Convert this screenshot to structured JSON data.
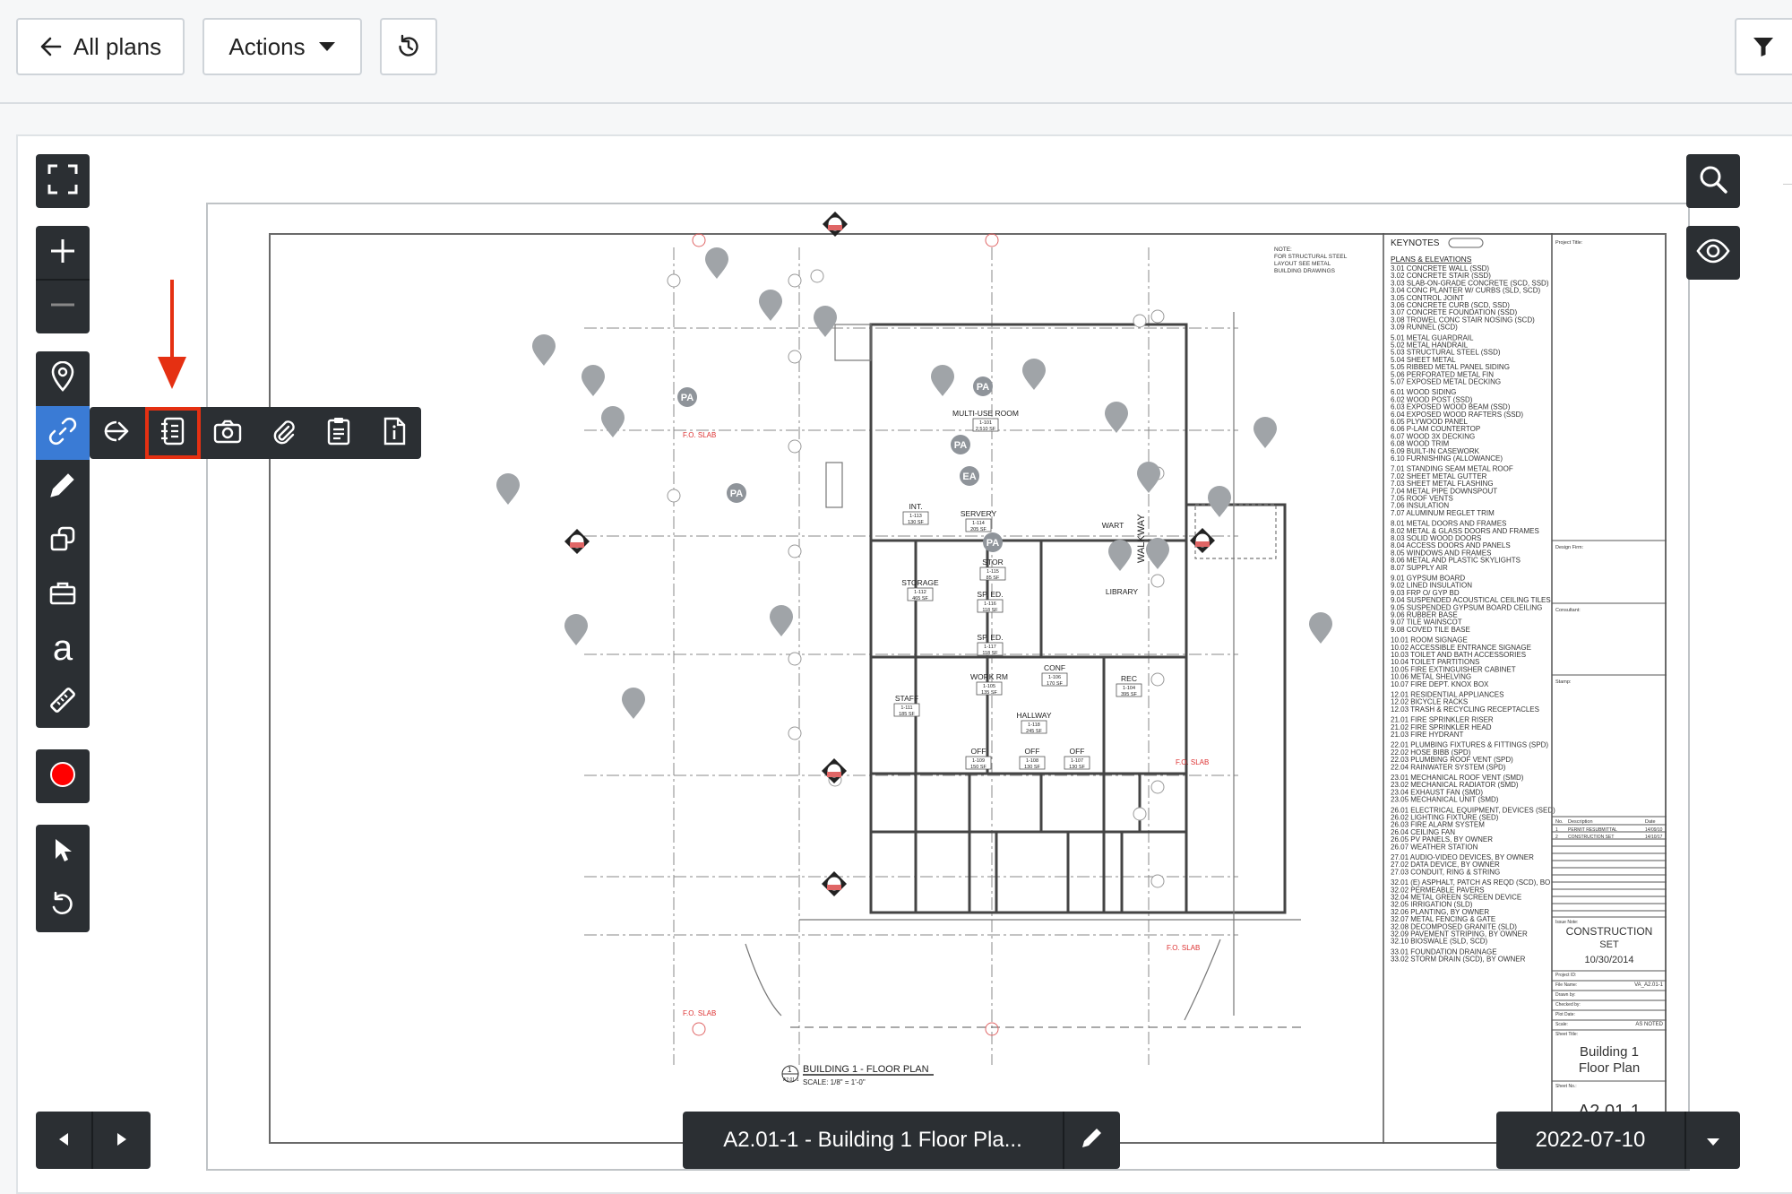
{
  "toolbar": {
    "all_plans_label": "All plans",
    "actions_label": "Actions"
  },
  "plan": {
    "keynotes_title": "KEYNOTES",
    "keynotes_section": "PLANS & ELEVATIONS",
    "keynotes": [
      "3.01  CONCRETE WALL (SSD)",
      "3.02  CONCRETE STAIR (SSD)",
      "3.03  SLAB-ON-GRADE CONCRETE (SCD, SSD)",
      "3.04  CONC PLANTER W/ CURBS (SLD, SCD)",
      "3.05  CONTROL JOINT",
      "3.06  CONCRETE CURB (SCD, SSD)",
      "3.07  CONCRETE FOUNDATION (SSD)",
      "3.08  TROWEL CONC STAIR NOSING (SCD)",
      "3.09  RUNNEL (SCD)",
      "",
      "5.01  METAL GUARDRAIL",
      "5.02  METAL HANDRAIL",
      "5.03  STRUCTURAL STEEL (SSD)",
      "5.04  SHEET METAL",
      "5.05  RIBBED METAL PANEL SIDING",
      "5.06  PERFORATED METAL FIN",
      "5.07  EXPOSED METAL DECKING",
      "",
      "6.01  WOOD SIDING",
      "6.02  WOOD POST (SSD)",
      "6.03  EXPOSED WOOD BEAM (SSD)",
      "6.04  EXPOSED WOOD RAFTERS (SSD)",
      "6.05  PLYWOOD PANEL",
      "6.06  P-LAM COUNTERTOP",
      "6.07  WOOD 3X DECKING",
      "6.08  WOOD TRIM",
      "6.09  BUILT-IN CASEWORK",
      "6.10  FURNISHING (ALLOWANCE)",
      "",
      "7.01  STANDING SEAM METAL ROOF",
      "7.02  SHEET METAL GUTTER",
      "7.03  SHEET METAL FLASHING",
      "7.04  METAL PIPE DOWNSPOUT",
      "7.05  ROOF VENTS",
      "7.06  INSULATION",
      "7.07  ALUMINUM REGLET TRIM",
      "",
      "8.01  METAL DOORS AND FRAMES",
      "8.02  METAL & GLASS DOORS AND FRAMES",
      "8.03  SOLID WOOD DOORS",
      "8.04  ACCESS DOORS AND PANELS",
      "8.05  WINDOWS AND FRAMES",
      "8.06  METAL AND PLASTIC SKYLIGHTS",
      "8.07  SUPPLY AIR",
      "",
      "9.01  GYPSUM BOARD",
      "9.02  LINED INSULATION",
      "9.03  FRP O/ GYP BD",
      "9.04  SUSPENDED ACOUSTICAL CEILING TILES",
      "9.05  SUSPENDED GYPSUM BOARD CEILING",
      "9.06  RUBBER BASE",
      "9.07  TILE WAINSCOT",
      "9.08  COVED TILE BASE",
      "",
      "10.01 ROOM SIGNAGE",
      "10.02 ACCESSIBLE ENTRANCE SIGNAGE",
      "10.03 TOILET AND BATH ACCESSORIES",
      "10.04 TOILET PARTITIONS",
      "10.05 FIRE EXTINGUISHER CABINET",
      "10.06 METAL SHELVING",
      "10.07 FIRE DEPT. KNOX BOX",
      "",
      "12.01 RESIDENTIAL APPLIANCES",
      "12.02 BICYCLE RACKS",
      "12.03 TRASH & RECYCLING RECEPTACLES",
      "",
      "21.01 FIRE SPRINKLER RISER",
      "21.02 FIRE SPRINKLER HEAD",
      "21.03 FIRE HYDRANT",
      "",
      "22.01 PLUMBING FIXTURES & FITTINGS (SPD)",
      "22.02 HOSE BIBB (SPD)",
      "22.03 PLUMBING ROOF VENT (SPD)",
      "22.04 RAINWATER SYSTEM (SPD)",
      "",
      "23.01 MECHANICAL ROOF VENT (SMD)",
      "23.02 MECHANICAL RADIATOR (SMD)",
      "23.04 EXHAUST FAN (SMD)",
      "23.05 MECHANICAL UNIT (SMD)",
      "",
      "26.01 ELECTRICAL EQUIPMENT, DEVICES (SED)",
      "26.02 LIGHTING FIXTURE (SED)",
      "26.03 FIRE ALARM SYSTEM",
      "26.04 CEILING FAN",
      "26.05 PV PANELS, BY OWNER",
      "26.07 WEATHER STATION",
      "",
      "27.01 AUDIO-VIDEO DEVICES, BY OWNER",
      "27.02 DATA DEVICE, BY OWNER",
      "27.03 CONDUIT, RING & STRING",
      "",
      "32.01 (E) ASPHALT, PATCH AS REQD (SCD), BO",
      "32.02 PERMEABLE PAVERS",
      "32.04 METAL GREEN SCREEN DEVICE",
      "32.05 IRRIGATION (SLD)",
      "32.06 PLANTING, BY OWNER",
      "32.07 METAL FENCING & GATE",
      "32.08 DECOMPOSED GRANITE (SLD)",
      "32.09 PAVEMENT STRIPING, BY OWNER",
      "32.10 BIOSWALE (SLD, SCD)",
      "",
      "33.01 FOUNDATION DRAINAGE",
      "33.02 STORM DRAIN (SCD), BY OWNER"
    ],
    "rooms": [
      {
        "name": "MULTI-USE ROOM",
        "num": "1-101",
        "area": "2,510 SF"
      },
      {
        "name": "INT.",
        "num": "1-113",
        "area": "130 SF"
      },
      {
        "name": "SERVERY",
        "num": "1-114",
        "area": "205 SF"
      },
      {
        "name": "WART",
        "num": "",
        "area": ""
      },
      {
        "name": "STOR",
        "num": "1-115",
        "area": "85 SF"
      },
      {
        "name": "STORAGE",
        "num": "1-112",
        "area": "465 SF"
      },
      {
        "name": "SP. ED.",
        "num": "1-116",
        "area": "118 SF"
      },
      {
        "name": "SP. ED.",
        "num": "1-117",
        "area": "118 SF"
      },
      {
        "name": "LIBRARY",
        "num": "",
        "area": ""
      },
      {
        "name": "WORK RM",
        "num": "1-105",
        "area": "135 SF"
      },
      {
        "name": "CONF",
        "num": "1-106",
        "area": "170 SF"
      },
      {
        "name": "REC",
        "num": "1-104",
        "area": "395 SF"
      },
      {
        "name": "STAFF",
        "num": "1-111",
        "area": "185 SF"
      },
      {
        "name": "HALLWAY",
        "num": "1-118",
        "area": "245 SF"
      },
      {
        "name": "OFF",
        "num": "1-109",
        "area": "150 SF"
      },
      {
        "name": "OFF",
        "num": "1-108",
        "area": "130 SF"
      },
      {
        "name": "OFF",
        "num": "1-107",
        "area": "130 SF"
      }
    ],
    "tag_pa": "PA",
    "tag_ea": "EA",
    "walkway": "WALKWAY",
    "slab": "F.O. SLAB",
    "note": [
      "NOTE:",
      "FOR STRUCTURAL STEEL",
      "LAYOUT SEE METAL",
      "BUILDING DRAWINGS"
    ],
    "caption_num": "1",
    "caption_ref": "A2.01-1",
    "caption_title": "BUILDING 1 - FLOOR PLAN",
    "caption_scale": "SCALE:  1/8\" = 1'-0\"",
    "titleblock": {
      "project_title": "Project Title:",
      "design_firm": "Design Firm:",
      "consultant": "Consultant:",
      "stamp": "Stamp:",
      "rev_header": [
        "No.",
        "Description",
        "Date"
      ],
      "revisions": [
        [
          "1",
          "PERMIT RESUBMITTAL",
          "14/09/10"
        ],
        [
          "2",
          "CONSTRUCTION SET",
          "14/10/17"
        ]
      ],
      "issue_note_label": "Issue Note:",
      "issue_note_line1": "CONSTRUCTION",
      "issue_note_line2": "SET",
      "issue_date": "10/30/2014",
      "project_id": "Project ID:",
      "file_name_label": "File Name:",
      "file_name": "VA_A2.01-1",
      "drawn_by": "Drawn by:",
      "checked_by": "Checked by:",
      "plot_date": "Plot Date:",
      "scale_label": "Scale:",
      "scale_value": "AS NOTED",
      "sheet_title_label": "Sheet Title:",
      "sheet_title_line1": "Building 1",
      "sheet_title_line2": "Floor Plan",
      "sheet_no_label": "Sheet No.:",
      "sheet_no": "A2.01-1"
    }
  },
  "footer": {
    "sheet_name": "A2.01-1 - Building 1 Floor Pla...",
    "date": "2022-07-10"
  },
  "colors": {
    "toolbar_bg": "#2b2f33",
    "active_tool": "#3a7bd5",
    "highlight": "#e53012",
    "record": "#ff0000"
  }
}
